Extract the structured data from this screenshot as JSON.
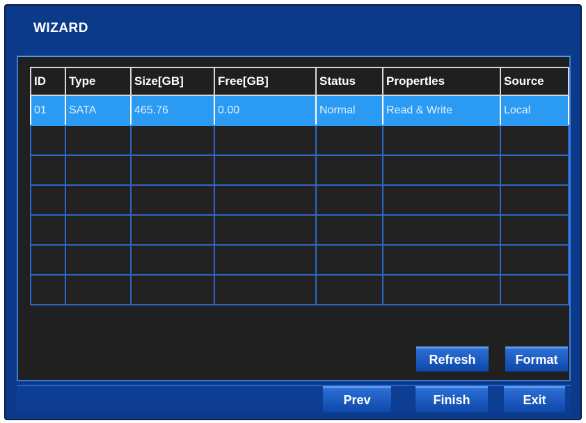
{
  "window": {
    "title": "WIZARD"
  },
  "table": {
    "headers": [
      "ID",
      "Type",
      "Size[GB]",
      "Free[GB]",
      "Status",
      "Propertles",
      "Source"
    ],
    "rows": [
      [
        "01",
        "SATA",
        "465.76",
        "0.00",
        "Normal",
        "Read & Write",
        "Local"
      ]
    ]
  },
  "actions": {
    "refresh_label": "Refresh",
    "format_label": "Format"
  },
  "footer": {
    "prev_label": "Prev",
    "finish_label": "Finish",
    "exit_label": "Exit"
  },
  "colors": {
    "window_bg": "#0c3a8a",
    "panel_bg": "#202020",
    "grid_line": "#2c67c7",
    "selected_row": "#2b9af3",
    "button": "#1a5cc4"
  }
}
